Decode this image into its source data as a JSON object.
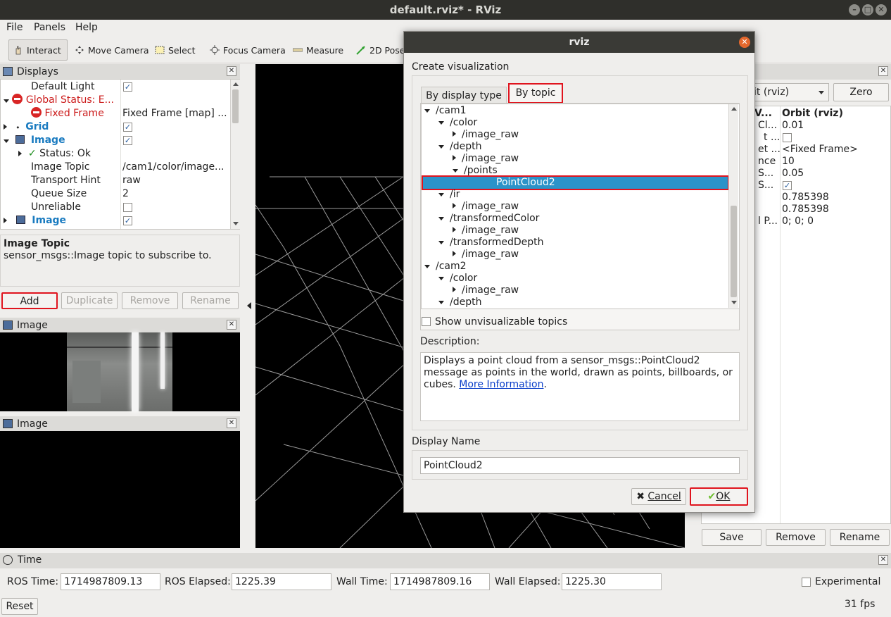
{
  "window": {
    "title": "default.rviz* - RViz"
  },
  "menu": {
    "file": "File",
    "panels": "Panels",
    "help": "Help"
  },
  "toolbar": {
    "interact": "Interact",
    "move_camera": "Move Camera",
    "select": "Select",
    "focus_camera": "Focus Camera",
    "measure": "Measure",
    "pose_estimate": "2D Pose"
  },
  "displays_panel": {
    "title": "Displays",
    "rows": [
      {
        "name": "Default Light",
        "value": ""
      },
      {
        "name": "Global Status: E...",
        "value": ""
      },
      {
        "name": "Fixed Frame",
        "value": "Fixed Frame [map] ..."
      },
      {
        "name": "Grid",
        "value": ""
      },
      {
        "name": "Image",
        "value": ""
      },
      {
        "name": "Status: Ok",
        "value": ""
      },
      {
        "name": "Image Topic",
        "value": "/cam1/color/image..."
      },
      {
        "name": "Transport Hint",
        "value": "raw"
      },
      {
        "name": "Queue Size",
        "value": "2"
      },
      {
        "name": "Unreliable",
        "value": ""
      },
      {
        "name": "Image",
        "value": ""
      }
    ],
    "description_title": "Image Topic",
    "description_text": "sensor_msgs::Image topic to subscribe to.",
    "buttons": {
      "add": "Add",
      "duplicate": "Duplicate",
      "remove": "Remove",
      "rename": "Rename"
    }
  },
  "image_panel_1": {
    "title": "Image"
  },
  "image_panel_2": {
    "title": "Image"
  },
  "views_panel": {
    "type_value": "it (rviz)",
    "zero": "Zero",
    "header_left": "V...",
    "header_right": "Orbit (rviz)",
    "rows": [
      {
        "name": "Cl...",
        "value": "0.01"
      },
      {
        "name": "t ...",
        "value": ""
      },
      {
        "name": "et ...",
        "value": "<Fixed Frame>"
      },
      {
        "name": "nce",
        "value": "10"
      },
      {
        "name": "S...",
        "value": "0.05"
      },
      {
        "name": "S...",
        "value": ""
      },
      {
        "name": "",
        "value": "0.785398"
      },
      {
        "name": "",
        "value": "0.785398"
      },
      {
        "name": "l P...",
        "value": "0; 0; 0"
      }
    ],
    "buttons": {
      "save": "Save",
      "remove": "Remove",
      "rename": "Rename"
    }
  },
  "dialog": {
    "title": "rviz",
    "heading": "Create visualization",
    "tab_display_type": "By display type",
    "tab_topic": "By topic",
    "tree": [
      {
        "label": "/cam1",
        "level": 0,
        "state": "open"
      },
      {
        "label": "/color",
        "level": 1,
        "state": "open"
      },
      {
        "label": "/image_raw",
        "level": 2,
        "state": "closed"
      },
      {
        "label": "/depth",
        "level": 1,
        "state": "open"
      },
      {
        "label": "/image_raw",
        "level": 2,
        "state": "closed"
      },
      {
        "label": "/points",
        "level": 2,
        "state": "open"
      },
      {
        "label": "PointCloud2",
        "level": 3,
        "state": "selected"
      },
      {
        "label": "/ir",
        "level": 1,
        "state": "open"
      },
      {
        "label": "/image_raw",
        "level": 2,
        "state": "closed"
      },
      {
        "label": "/transformedColor",
        "level": 1,
        "state": "open"
      },
      {
        "label": "/image_raw",
        "level": 2,
        "state": "closed"
      },
      {
        "label": "/transformedDepth",
        "level": 1,
        "state": "open"
      },
      {
        "label": "/image_raw",
        "level": 2,
        "state": "closed"
      },
      {
        "label": "/cam2",
        "level": 0,
        "state": "open"
      },
      {
        "label": "/color",
        "level": 1,
        "state": "open"
      },
      {
        "label": "/image_raw",
        "level": 2,
        "state": "closed"
      },
      {
        "label": "/depth",
        "level": 1,
        "state": "open"
      }
    ],
    "show_unvisualizable": "Show unvisualizable topics",
    "description_label": "Description:",
    "description_text": "Displays a point cloud from a sensor_msgs::PointCloud2 message as points in the world, drawn as points, billboards, or cubes.",
    "description_link": "More Information",
    "display_name_label": "Display Name",
    "display_name_value": "PointCloud2",
    "cancel": "Cancel",
    "ok": "OK"
  },
  "time_panel": {
    "title": "Time",
    "ros_time_label": "ROS Time:",
    "ros_time": "1714987809.13",
    "ros_elapsed_label": "ROS Elapsed:",
    "ros_elapsed": "1225.39",
    "wall_time_label": "Wall Time:",
    "wall_time": "1714987809.16",
    "wall_elapsed_label": "Wall Elapsed:",
    "wall_elapsed": "1225.30",
    "experimental": "Experimental",
    "reset": "Reset",
    "fps": "31 fps"
  }
}
